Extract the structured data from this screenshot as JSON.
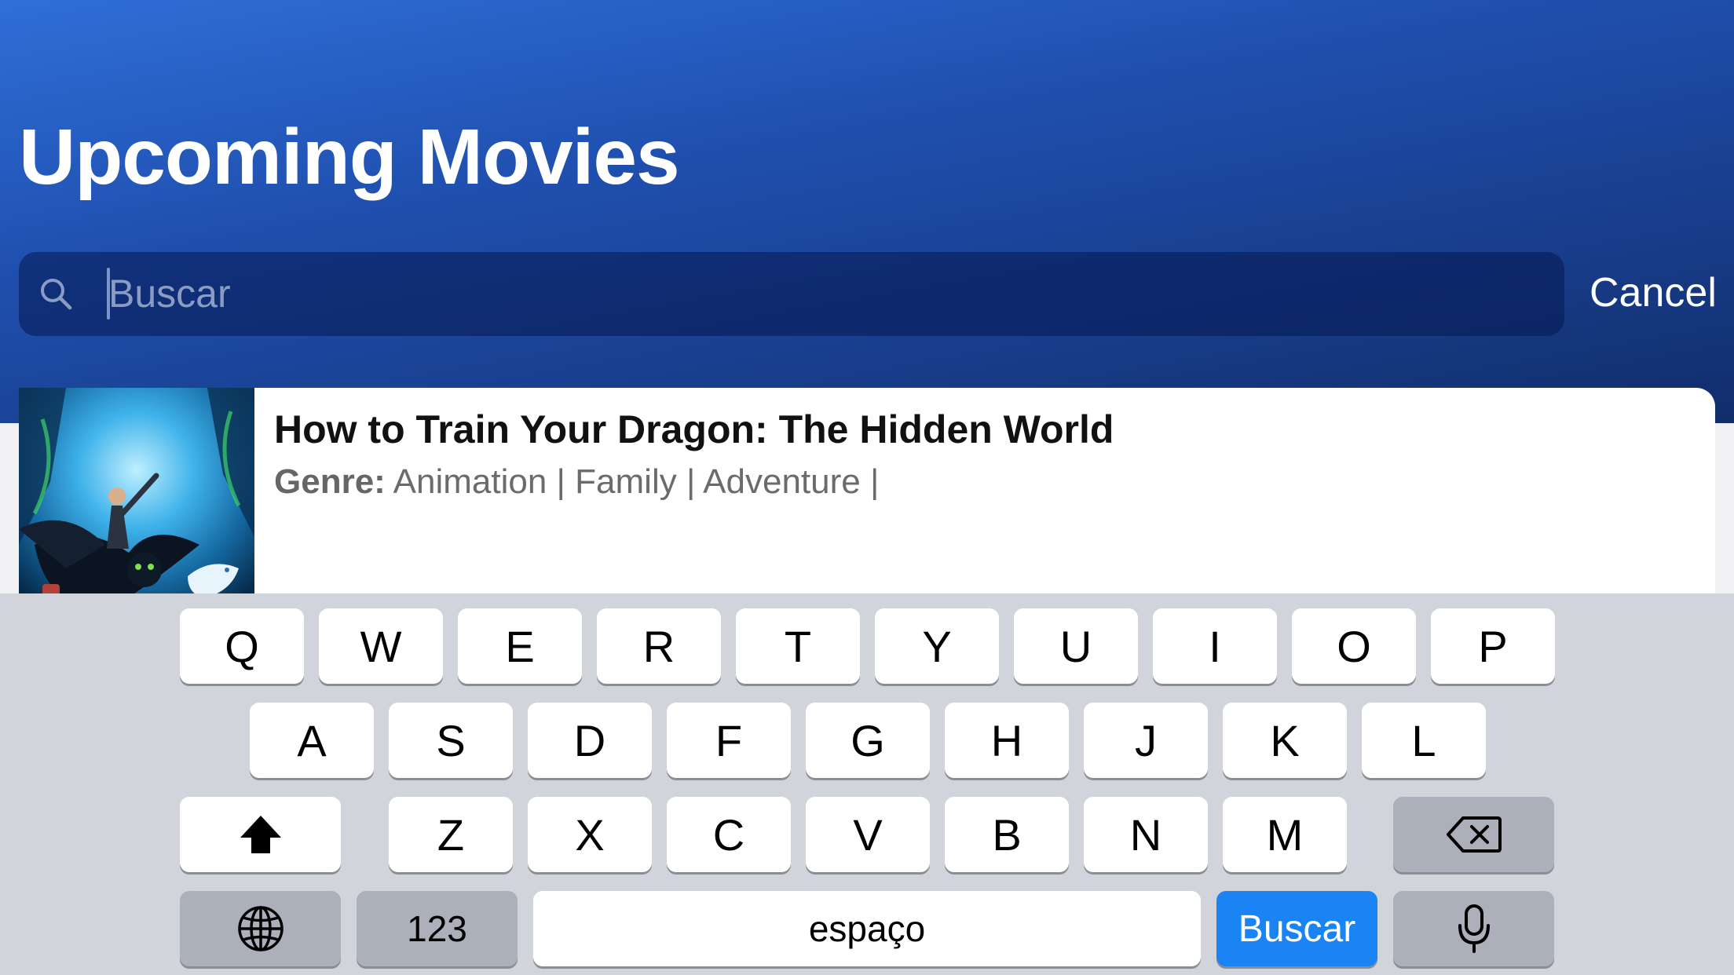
{
  "header": {
    "title": "Upcoming Movies"
  },
  "search": {
    "placeholder": "Buscar",
    "cancel_label": "Cancel"
  },
  "results": [
    {
      "title": "How to Train Your Dragon: The Hidden World",
      "genre_label": "Genre:",
      "genres": "Animation | Family | Adventure |"
    }
  ],
  "keyboard": {
    "row1": [
      "Q",
      "W",
      "E",
      "R",
      "T",
      "Y",
      "U",
      "I",
      "O",
      "P"
    ],
    "row2": [
      "A",
      "S",
      "D",
      "F",
      "G",
      "H",
      "J",
      "K",
      "L"
    ],
    "row3": [
      "Z",
      "X",
      "C",
      "V",
      "B",
      "N",
      "M"
    ],
    "numbers_label": "123",
    "space_label": "espaço",
    "return_label": "Buscar",
    "icons": {
      "shift": "shift-icon",
      "delete": "delete-icon",
      "globe": "globe-icon",
      "mic": "microphone-icon"
    },
    "return_color": "#1a84f5"
  }
}
